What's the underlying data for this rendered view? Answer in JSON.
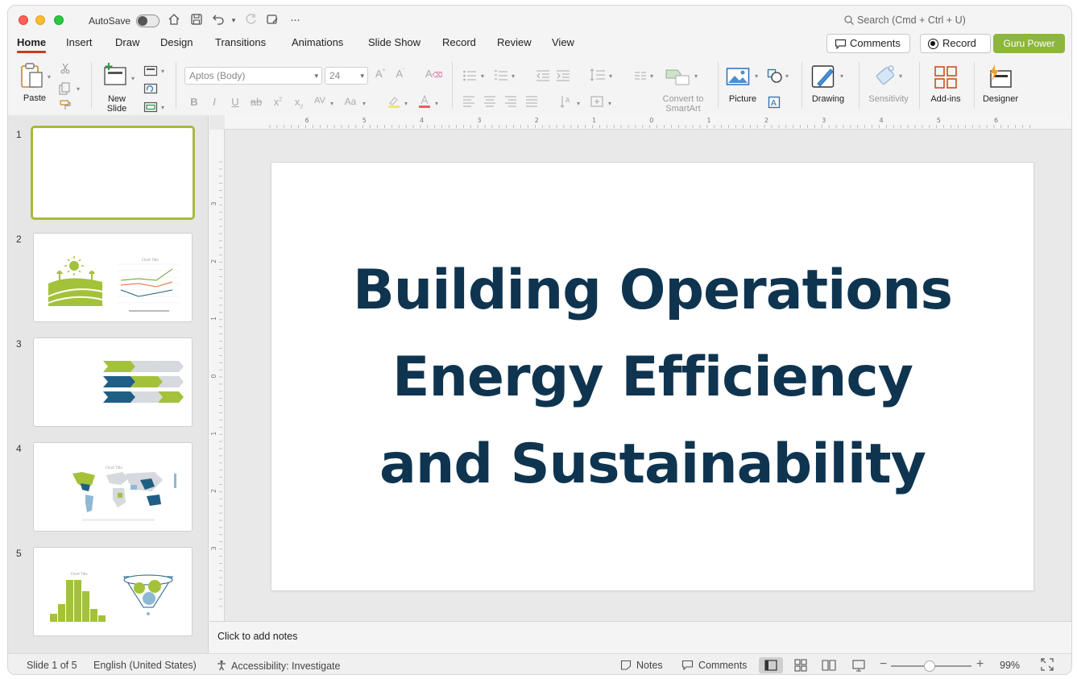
{
  "titlebar": {
    "autosave_label": "AutoSave",
    "search_placeholder": "Search (Cmd + Ctrl + U)"
  },
  "tabs": [
    {
      "label": "Home",
      "active": true
    },
    {
      "label": "Insert"
    },
    {
      "label": "Draw"
    },
    {
      "label": "Design"
    },
    {
      "label": "Transitions"
    },
    {
      "label": "Animations"
    },
    {
      "label": "Slide Show"
    },
    {
      "label": "Record"
    },
    {
      "label": "Review"
    },
    {
      "label": "View"
    }
  ],
  "actions": {
    "comments_label": "Comments",
    "record_label": "Record",
    "guru_label": "Guru Power"
  },
  "ribbon": {
    "paste_label": "Paste",
    "new_slide_label_1": "New",
    "new_slide_label_2": "Slide",
    "font_name": "Aptos (Body)",
    "font_size": "24",
    "convert_label_1": "Convert to",
    "convert_label_2": "SmartArt",
    "picture_label": "Picture",
    "drawing_label": "Drawing",
    "sensitivity_label": "Sensitivity",
    "addins_label": "Add-ins",
    "designer_label": "Designer"
  },
  "thumbnails": [
    {
      "number": "1"
    },
    {
      "number": "2"
    },
    {
      "number": "3"
    },
    {
      "number": "4"
    },
    {
      "number": "5"
    }
  ],
  "slide": {
    "title_lines": [
      "Building Operations",
      "Energy Efficiency",
      "and Sustainability"
    ],
    "title_color": "#0e3450"
  },
  "notes": {
    "placeholder": "Click to add notes"
  },
  "status": {
    "slide_counter": "Slide 1 of 5",
    "language": "English (United States)",
    "accessibility": "Accessibility: Investigate",
    "notes_label": "Notes",
    "comments_label": "Comments",
    "zoom": "99%"
  },
  "ruler": {
    "h_labels": [
      "6",
      "5",
      "4",
      "3",
      "2",
      "1",
      "0",
      "1",
      "2",
      "3",
      "4",
      "5",
      "6"
    ],
    "v_labels": [
      "3",
      "2",
      "1",
      "0",
      "1",
      "2",
      "3"
    ]
  },
  "colors": {
    "accent_green": "#8db63c",
    "tab_underline": "#c43e1c",
    "navy": "#0e3450",
    "teal_blue": "#1f5f85"
  }
}
